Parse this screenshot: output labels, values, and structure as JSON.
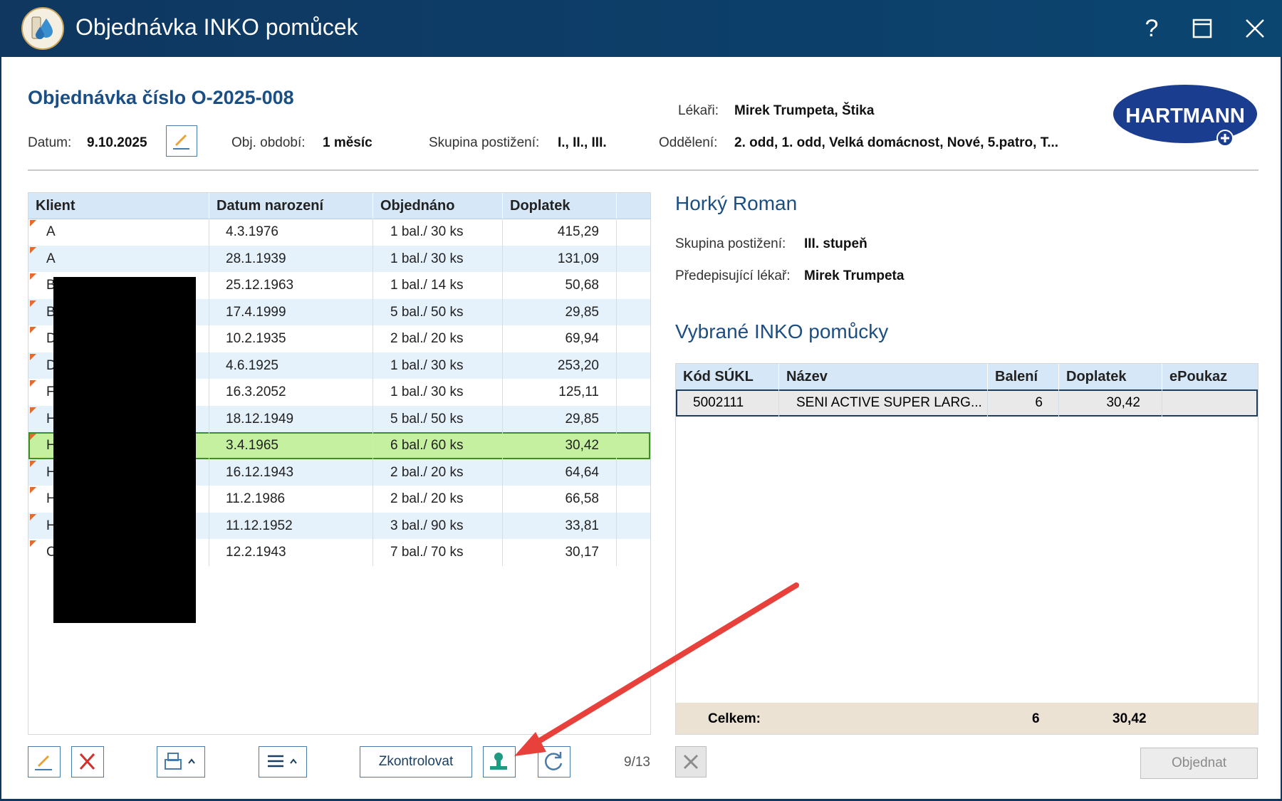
{
  "window": {
    "title": "Objednávka INKO pomůcek",
    "controls": {
      "help": "?",
      "maximize": "☐",
      "close": "✕"
    }
  },
  "header": {
    "order_title": "Objednávka číslo O-2025-008",
    "date_label": "Datum:",
    "date_value": "9.10.2025",
    "period_label": "Obj. období:",
    "period_value": "1 měsíc",
    "group_label": "Skupina postižení:",
    "group_value": "I., II., III.",
    "doctors_label": "Lékaři:",
    "doctors_value": "Mirek Trumpeta, Štika",
    "dept_label": "Oddělení:",
    "dept_value": "2. odd, 1. odd, Velká domácnost, Nové, 5.patro, T...",
    "logo_text": "HARTMANN"
  },
  "clients_table": {
    "columns": [
      "Klient",
      "Datum narození",
      "Objednáno",
      "Doplatek"
    ],
    "rows": [
      {
        "initial": "A",
        "dob": "4.3.1976",
        "ordered": "1 bal./ 30 ks",
        "copay": "415,29"
      },
      {
        "initial": "A",
        "dob": "28.1.1939",
        "ordered": "1 bal./ 30 ks",
        "copay": "131,09"
      },
      {
        "initial": "B",
        "dob": "25.12.1963",
        "ordered": "1 bal./ 14 ks",
        "copay": "50,68"
      },
      {
        "initial": "B",
        "dob": "17.4.1999",
        "ordered": "5 bal./ 50 ks",
        "copay": "29,85"
      },
      {
        "initial": "D",
        "dob": "10.2.1935",
        "ordered": "2 bal./ 20 ks",
        "copay": "69,94"
      },
      {
        "initial": "D",
        "dob": "4.6.1925",
        "ordered": "1 bal./ 30 ks",
        "copay": "253,20"
      },
      {
        "initial": "F",
        "dob": "16.3.2052",
        "ordered": "1 bal./ 30 ks",
        "copay": "125,11"
      },
      {
        "initial": "H",
        "dob": "18.12.1949",
        "ordered": "5 bal./ 50 ks",
        "copay": "29,85"
      },
      {
        "initial": "H",
        "dob": "3.4.1965",
        "ordered": "6 bal./ 60 ks",
        "copay": "30,42"
      },
      {
        "initial": "H",
        "dob": "16.12.1943",
        "ordered": "2 bal./ 20 ks",
        "copay": "64,64"
      },
      {
        "initial": "H",
        "dob": "11.2.1986",
        "ordered": "2 bal./ 20 ks",
        "copay": "66,58"
      },
      {
        "initial": "H",
        "dob": "11.12.1952",
        "ordered": "3 bal./ 90 ks",
        "copay": "33,81"
      },
      {
        "initial": "C",
        "dob": "12.2.1943",
        "ordered": "7 bal./ 70 ks",
        "copay": "30,17"
      }
    ],
    "selected_index": 8
  },
  "client_detail": {
    "name": "Horký Roman",
    "group_label": "Skupina postižení:",
    "group_value": "III. stupeň",
    "doctor_label": "Předepisující lékař:",
    "doctor_value": "Mirek Trumpeta"
  },
  "items": {
    "title": "Vybrané INKO pomůcky",
    "columns": [
      "Kód SÚKL",
      "Název",
      "Balení",
      "Doplatek",
      "ePoukaz"
    ],
    "rows": [
      {
        "code": "5002111",
        "name": "SENI ACTIVE SUPER LARG...",
        "packs": "6",
        "copay": "30,42",
        "epoukaz": ""
      }
    ],
    "total_label": "Celkem:",
    "total_packs": "6",
    "total_copay": "30,42"
  },
  "toolbar": {
    "check_label": "Zkontrolovat",
    "pager": "9/13",
    "order_label": "Objednat"
  },
  "colors": {
    "title_bar": "#0f3760",
    "accent_blue": "#1b4e83",
    "selected_row": "#c4f0a0",
    "arrow": "#e8413c"
  }
}
